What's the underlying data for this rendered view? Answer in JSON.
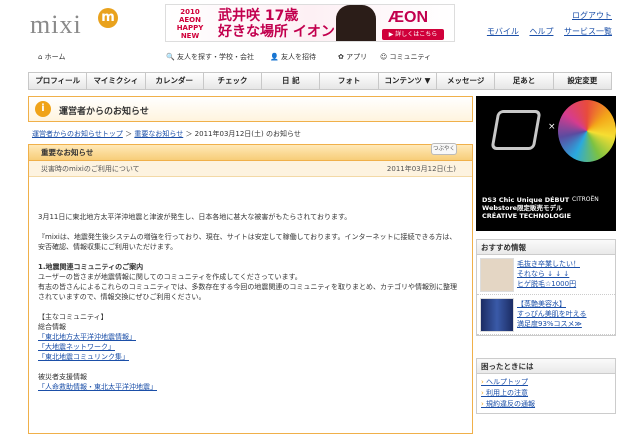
{
  "header": {
    "logo_text": "mixi",
    "logo_badge": "m",
    "banner": {
      "left_lines": "2010 AEON HAPPY NEW AEON SALE",
      "main_line1": "武井咲 17歳",
      "main_line2": "好きな場所 イオン",
      "brand": "ÆON",
      "cta": "▶ 詳しくはこちら"
    },
    "top_links": {
      "logout": "ログアウト",
      "mobile": "モバイル",
      "help": "ヘルプ",
      "service": "サービス一覧"
    }
  },
  "subnav": {
    "home": "ホーム",
    "find_friends": "友人を探す・学校・会社",
    "invite": "友人を招待",
    "apps": "アプリ",
    "community": "コミュニティ"
  },
  "navbar": [
    "プロフィール",
    "マイミクシィ",
    "カレンダー",
    "チェック",
    "日 記",
    "フォト",
    "コンテンツ ▼",
    "メッセージ",
    "足あと",
    "設定変更"
  ],
  "main": {
    "title": "運営者からのお知らせ",
    "breadcrumb": {
      "top": "運営者からのお知らせトップ",
      "sep1": "＞",
      "important": "重要なお知らせ",
      "sep2": "＞ 2011年03月12日(土) のお知らせ"
    },
    "section_title": "重要なお知らせ",
    "notice_title": "災害時のmixiのご利用について",
    "notice_date": "2011年03月12日(土)",
    "tweet_label": "つぶやく",
    "body": {
      "p1": "3月11日に東北地方太平洋沖地震と津波が発生し、日本各地に甚大な被害がもたらされております。",
      "p2": "『mixiは、地震発生後システムの増強を行っており、現在、サイトは安定して稼働しております。インターネットに接続できる方は、安否確認、情報収集にご利用いただけます。",
      "h1": "1.地震関連コミュニティのご案内",
      "p3a": "ユーザーの皆さまが地震情報に関してのコミュニティを作成してくださっています。",
      "p3b": "有志の皆さんによるこれらのコミュニティでは、多数存在する今回の地震関連のコミュニティを取りまとめ、カテゴリや情報別に整理されていますので、情報交換にぜひご利用ください。",
      "main_comm": "【主なコミュニティ】",
      "general": "総合情報",
      "link1": "「東北地方太平洋沖地震情報」",
      "link2": "「大地震ネットワーク」",
      "link3": "「東北地震コミュリンク集」",
      "support": "被災者支援情報",
      "link4": "「人命救助情報・東北太平洋沖地震」"
    }
  },
  "sidebar": {
    "ad": {
      "x_mark": "×",
      "line1": "DS3 Chic Unique DÉBUT",
      "line2": "Webstore限定販売モデル",
      "line3": "CRÉATIVE TECHNOLOGIE",
      "brand": "CITROËN"
    },
    "recommend_title": "おすすめ情報",
    "rec1_line1": "毛抜き卒業したい！",
    "rec1_line2": "それなら ↓ ↓ ↓",
    "rec1_line3": "ヒゲ脱毛☆1000円",
    "rec2_line1": "【蒸艶美容水】",
    "rec2_line2": "すっぴん美肌を叶える",
    "rec2_line3": "満足度93%コスメ≫",
    "help_title": "困ったときには",
    "help_items": [
      "ヘルプトップ",
      "利用上の注意",
      "規約違反の通報"
    ]
  }
}
